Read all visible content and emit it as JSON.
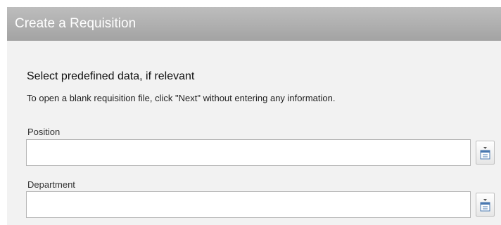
{
  "dialog": {
    "title": "Create a Requisition"
  },
  "section": {
    "title": "Select predefined data, if relevant",
    "instruction": "To open a blank requisition file, click \"Next\" without entering any information."
  },
  "fields": {
    "position": {
      "label": "Position",
      "value": ""
    },
    "department": {
      "label": "Department",
      "value": ""
    }
  },
  "icons": {
    "picker": "list-picker-icon"
  },
  "colors": {
    "header_bg": "#aaaaaa",
    "panel_bg": "#f2f2f2",
    "icon_accent": "#4a78b0"
  }
}
